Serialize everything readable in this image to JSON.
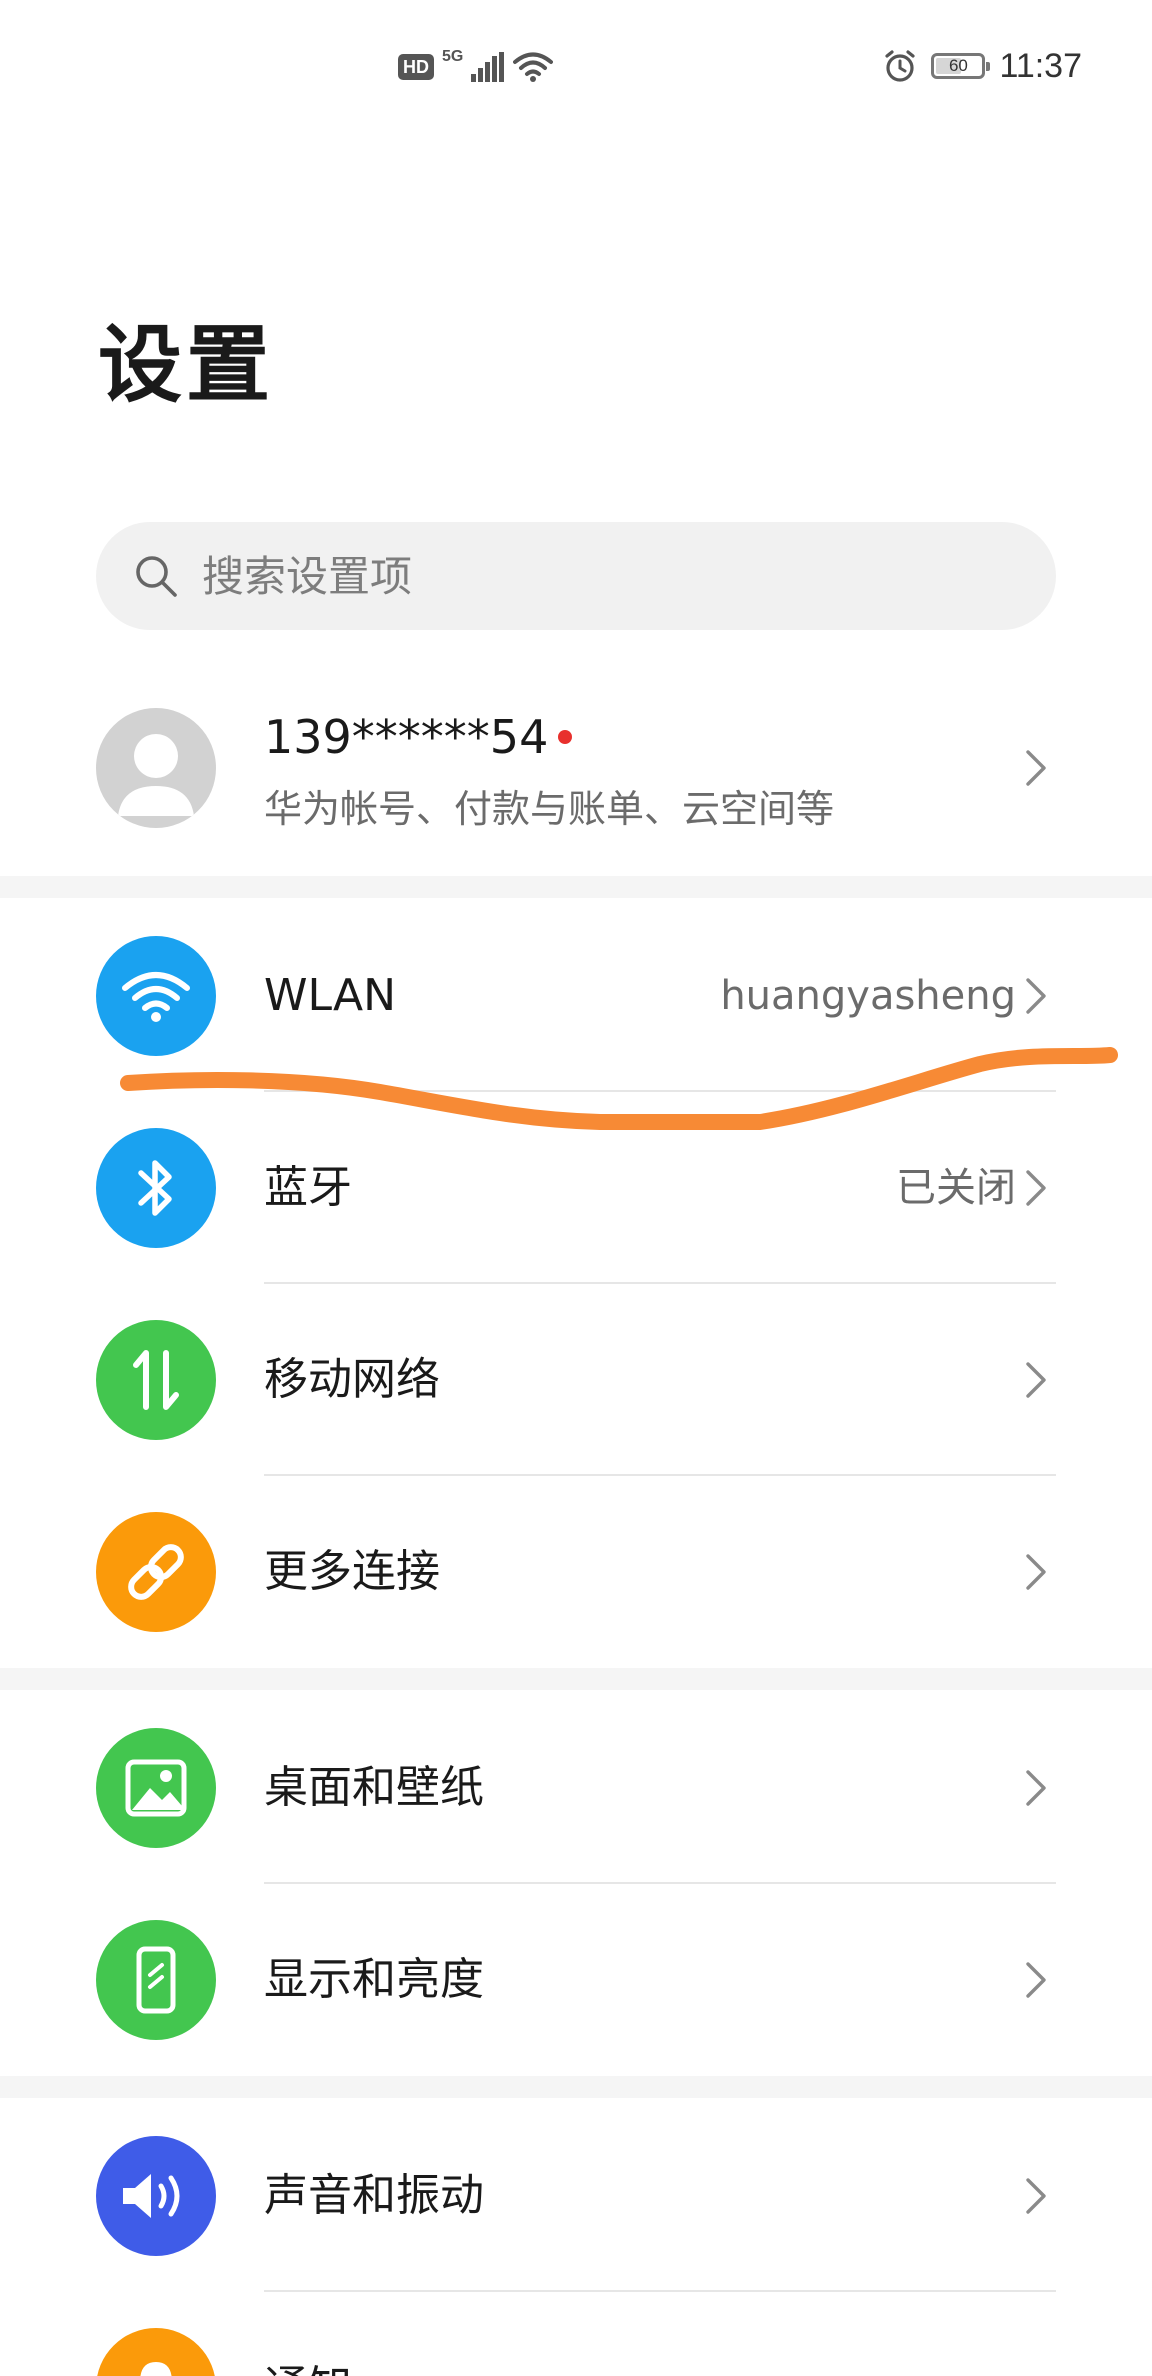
{
  "status_bar": {
    "hd": "HD",
    "network": "5G",
    "battery": "60",
    "battery_level": 0.6,
    "time": "11:37",
    "icons": [
      "hd-badge",
      "signal-icon",
      "wifi-icon",
      "alarm-icon",
      "battery-icon"
    ]
  },
  "title": "设置",
  "search": {
    "placeholder": "搜索设置项"
  },
  "account": {
    "name": "139******54",
    "subtitle": "华为帐号、付款与账单、云空间等"
  },
  "items": [
    {
      "id": "wlan",
      "label": "WLAN",
      "value": "huangyasheng",
      "icon": "wifi-icon",
      "color": "#1aa2f0"
    },
    {
      "id": "bluetooth",
      "label": "蓝牙",
      "value": "已关闭",
      "icon": "bluetooth-icon",
      "color": "#1aa2f0"
    },
    {
      "id": "mobile-network",
      "label": "移动网络",
      "value": "",
      "icon": "mobile-data-icon",
      "color": "#43c64f"
    },
    {
      "id": "more-connections",
      "label": "更多连接",
      "value": "",
      "icon": "link-icon",
      "color": "#fb9a0a"
    },
    {
      "id": "desktop-wallpaper",
      "label": "桌面和壁纸",
      "value": "",
      "icon": "image-icon",
      "color": "#43c64f"
    },
    {
      "id": "display-brightness",
      "label": "显示和亮度",
      "value": "",
      "icon": "phone-display-icon",
      "color": "#43c64f"
    },
    {
      "id": "sound-vibration",
      "label": "声音和振动",
      "value": "",
      "icon": "speaker-icon",
      "color": "#3f5ce8"
    },
    {
      "id": "notifications",
      "label": "通知",
      "value": "",
      "icon": "bell-icon",
      "color": "#fb9a0a"
    }
  ],
  "colors": {
    "annotation_stroke": "#f78a35",
    "accent_red": "#e8302d"
  }
}
